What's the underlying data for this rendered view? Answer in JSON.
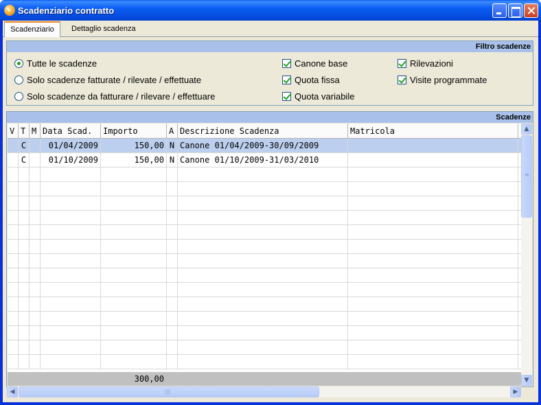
{
  "window": {
    "title": "Scadenziario contratto"
  },
  "tabs": [
    {
      "label": "Scadenziario",
      "active": true
    },
    {
      "label": "Dettaglio scadenza",
      "active": false
    }
  ],
  "filter": {
    "header": "Filtro scadenze",
    "radios": [
      {
        "label": "Tutte le scadenze",
        "checked": true
      },
      {
        "label": "Solo scadenze fatturate / rilevate / effettuate",
        "checked": false
      },
      {
        "label": "Solo scadenze da fatturare / rilevare / effettuare",
        "checked": false
      }
    ],
    "checks_col1": [
      {
        "label": "Canone base",
        "checked": true
      },
      {
        "label": "Quota fissa",
        "checked": true
      },
      {
        "label": "Quota variabile",
        "checked": true
      }
    ],
    "checks_col2": [
      {
        "label": "Rilevazioni",
        "checked": true
      },
      {
        "label": "Visite programmate",
        "checked": true
      }
    ]
  },
  "grid": {
    "header": "Scadenze",
    "columns": [
      "V",
      "T",
      "M",
      "Data Scad.",
      "Importo",
      "A",
      "Descrizione Scadenza",
      "Matricola"
    ],
    "rows": [
      {
        "v": "",
        "t": "C",
        "m": "",
        "data": "01/04/2009",
        "importo": "150,00",
        "a": "N",
        "descrizione": "Canone 01/04/2009-30/09/2009",
        "matricola": "",
        "selected": true
      },
      {
        "v": "",
        "t": "C",
        "m": "",
        "data": "01/10/2009",
        "importo": "150,00",
        "a": "N",
        "descrizione": "Canone 01/10/2009-31/03/2010",
        "matricola": "",
        "selected": false
      }
    ],
    "total": "300,00"
  },
  "colors": {
    "titlebar": "#0a5df3",
    "group_header": "#a9c1ea",
    "selection": "#bccfee",
    "check": "#21a121"
  }
}
